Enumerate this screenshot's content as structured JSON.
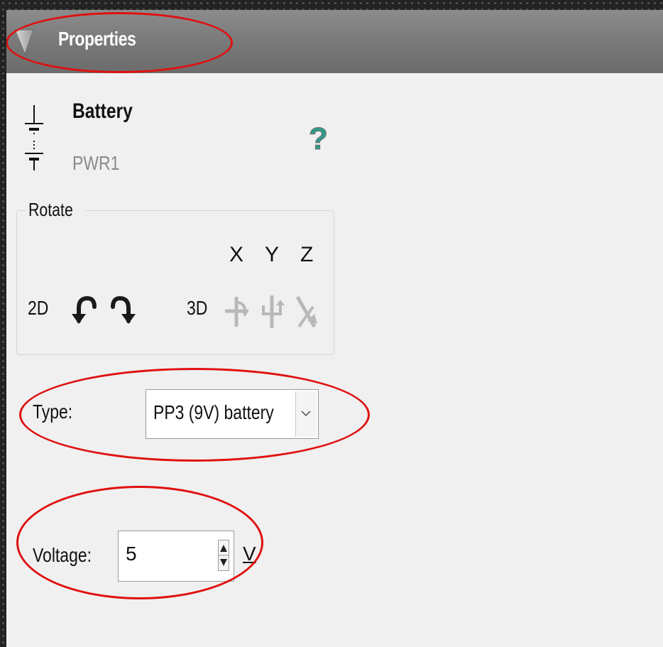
{
  "panel": {
    "title": "Properties",
    "collapse_icon": "triangle-down-icon",
    "header_color": "#7a7a7a"
  },
  "component": {
    "icon": "battery-icon",
    "name": "Battery",
    "ref": "PWR1",
    "help_icon": "question-mark-icon"
  },
  "rotate": {
    "group_label": "Rotate",
    "label_2d": "2D",
    "label_3d": "3D",
    "axes": [
      "X",
      "Y",
      "Z"
    ],
    "icons_2d": [
      "rotate-ccw-icon",
      "rotate-cw-icon"
    ],
    "icons_3d": [
      "rotate-x-icon",
      "rotate-y-icon",
      "rotate-z-icon"
    ]
  },
  "type": {
    "label": "Type:",
    "value": "PP3 (9V) battery"
  },
  "voltage": {
    "label": "Voltage:",
    "value": "5",
    "unit": "V"
  },
  "colors": {
    "annotation": "#e01010",
    "help_icon": "#2f9d8a",
    "disabled_icon": "#b8b8b8"
  }
}
